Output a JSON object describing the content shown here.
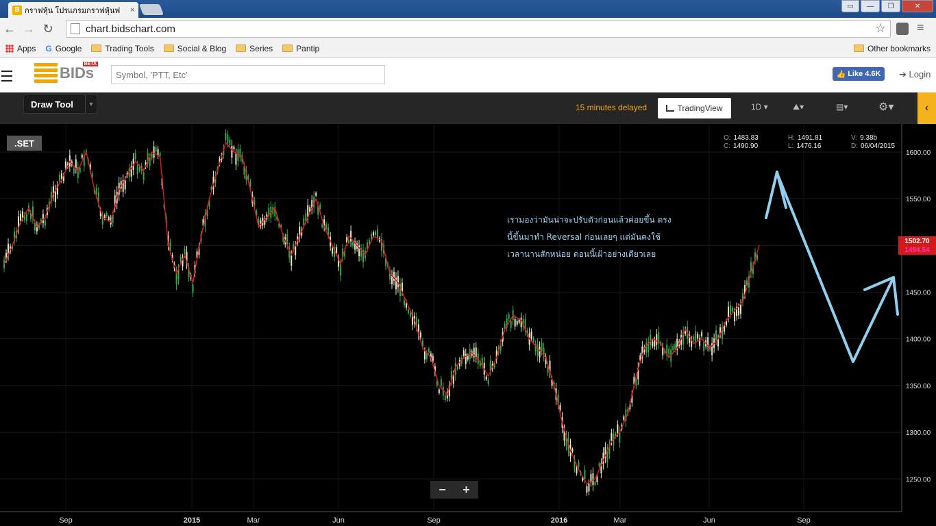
{
  "browser": {
    "tab_title": "กราฟหุ้น โปรแกรมกราฟหุ้นฟ",
    "tab_close": "×",
    "url": "chart.bidschart.com",
    "bookmarks": [
      {
        "label": "Apps",
        "icon": "apps-icon"
      },
      {
        "label": "Google",
        "icon": "google-icon"
      },
      {
        "label": "Trading Tools",
        "icon": "folder-icon"
      },
      {
        "label": "Social & Blog",
        "icon": "folder-icon"
      },
      {
        "label": "Series",
        "icon": "folder-icon"
      },
      {
        "label": "Pantip",
        "icon": "folder-icon"
      }
    ],
    "other_bookmarks": "Other bookmarks"
  },
  "site": {
    "logo_text": "BIDs",
    "logo_badge": "BETA",
    "search_placeholder": "Symbol, 'PTT, Etc'",
    "like_label": "Like 4.6K",
    "login_label": "Login"
  },
  "chart_toolbar": {
    "draw_tool": "Draw Tool",
    "delayed_notice": "15 minutes delayed",
    "tradingview_label": "TradingView",
    "interval": "1D"
  },
  "chart": {
    "symbol": ".SET",
    "ohlc": {
      "open": "1483.83",
      "high": "1491.81",
      "volume": "9.38b",
      "close": "1490.90",
      "low": "1476.16",
      "date": "06/04/2015"
    },
    "annotation_lines": [
      "เรามองว่ามันน่าจะปรับตัวก่อนแล้วค่อยขึ้น   ตรง",
      "นี้ขึ้นมาทำ   Reversal ก่อนเลยๆ   แต่มันคงใช้",
      "เวลานานสักหน่อย   ตอนนี้เฝ้าอย่างเดียวเลย"
    ],
    "price_badges": [
      "1502.70",
      "1494.54"
    ],
    "zoom_out": "−",
    "zoom_in": "+",
    "accent_color": "#f5b21a",
    "candle_up": "#e8e8c8",
    "candle_down": "#3aa84a",
    "ma_color": "#e01b1b",
    "arrow_color": "#8fd0ee"
  },
  "chart_data": {
    "type": "line",
    "title": "",
    "xlabel": "",
    "ylabel": "",
    "ylim": [
      1215,
      1630
    ],
    "x_ticks": [
      "Sep",
      "2015",
      "Mar",
      "Jun",
      "Sep",
      "2016",
      "Mar",
      "Jun",
      "Sep"
    ],
    "y_ticks": [
      "1600.00",
      "1550.00",
      "1500.00",
      "1450.00",
      "1400.00",
      "1350.00",
      "1300.00",
      "1250.00"
    ],
    "series": [
      {
        "values": [
          1480,
          1500,
          1525,
          1540,
          1520,
          1530,
          1555,
          1570,
          1590,
          1580,
          1600,
          1560,
          1530,
          1525,
          1560,
          1575,
          1590,
          1580,
          1600,
          1595,
          1500,
          1470,
          1490,
          1460,
          1510,
          1550,
          1580,
          1610,
          1600,
          1595,
          1560,
          1520,
          1530,
          1540,
          1510,
          1490,
          1510,
          1530,
          1550,
          1520,
          1500,
          1480,
          1510,
          1500,
          1490,
          1510,
          1505,
          1470,
          1460,
          1440,
          1420,
          1390,
          1380,
          1350,
          1340,
          1370,
          1380,
          1385,
          1375,
          1360,
          1380,
          1410,
          1425,
          1420,
          1400,
          1390,
          1380,
          1350,
          1310,
          1280,
          1260,
          1245,
          1250,
          1270,
          1290,
          1300,
          1320,
          1360,
          1390,
          1400,
          1395,
          1380,
          1390,
          1410,
          1395,
          1400,
          1390,
          1400,
          1420,
          1430,
          1440,
          1470,
          1500
        ]
      }
    ]
  }
}
